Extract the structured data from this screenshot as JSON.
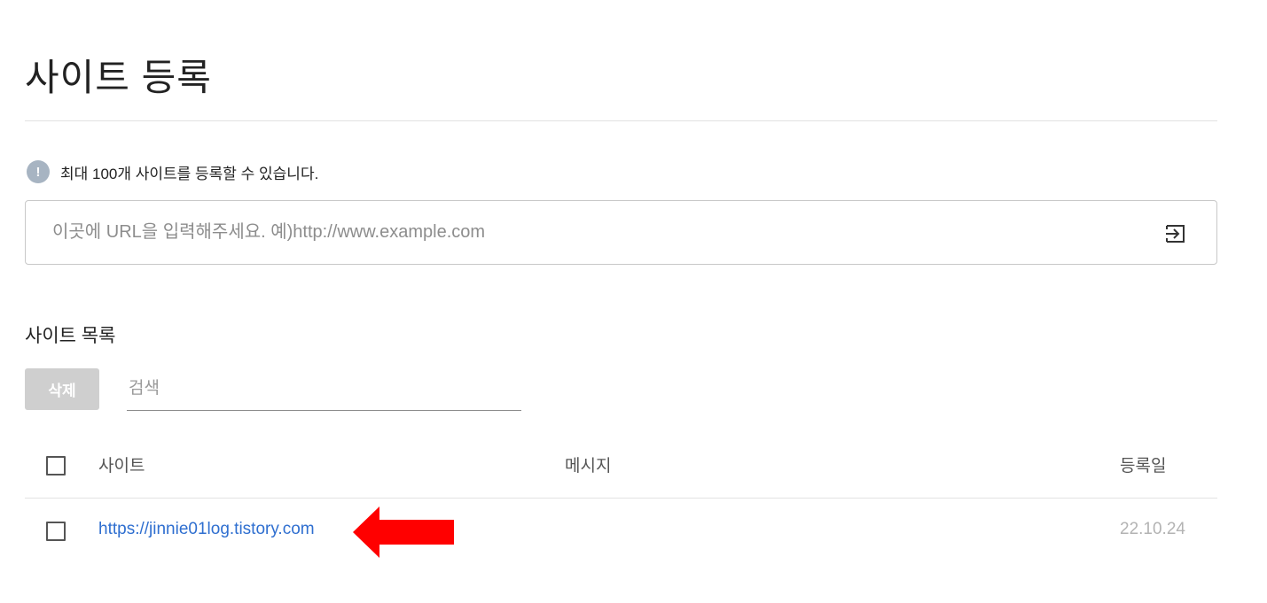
{
  "page": {
    "title": "사이트 등록",
    "notice_icon": "exclamation-info-icon",
    "notice": "최대 100개 사이트를 등록할 수 있습니다."
  },
  "url_form": {
    "value": "",
    "placeholder": "이곳에 URL을 입력해주세요. 예)http://www.example.com",
    "submit_icon": "enter-arrow-icon"
  },
  "site_list": {
    "title": "사이트 목록",
    "delete_label": "삭제",
    "search_value": "",
    "search_placeholder": "검색",
    "columns": {
      "site": "사이트",
      "message": "메시지",
      "date": "등록일"
    },
    "rows": [
      {
        "checked": false,
        "site": "https://jinnie01log.tistory.com",
        "message": "",
        "date": "22.10.24"
      }
    ]
  },
  "annotation": {
    "arrow_color": "#ff0000",
    "arrow_direction": "left"
  },
  "colors": {
    "link": "#2f6fd0",
    "delete_button_bg": "#cfcfcf",
    "notice_icon_bg": "#a7b4c2"
  }
}
